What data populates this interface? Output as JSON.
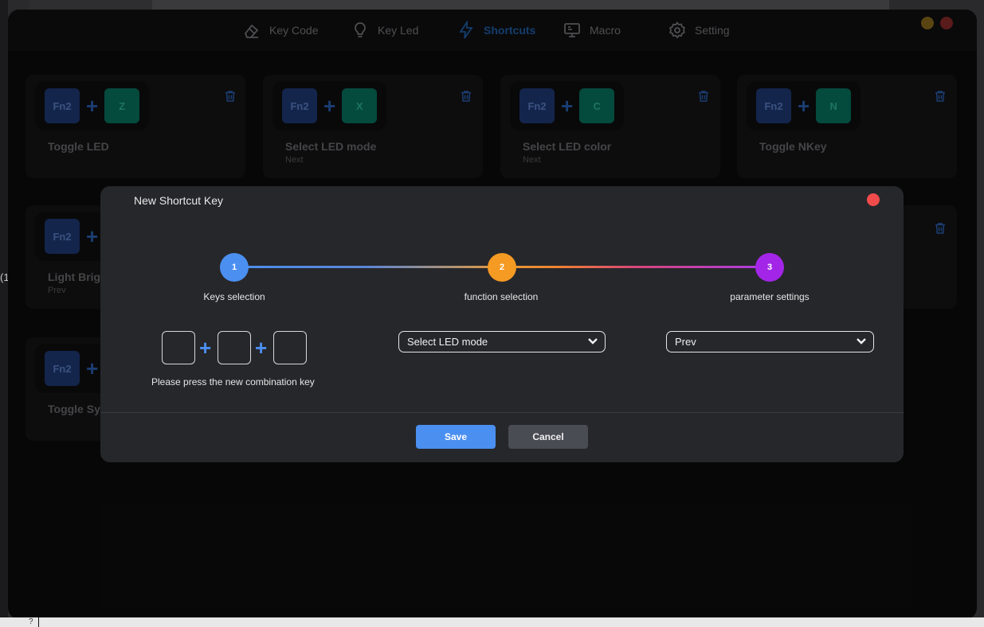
{
  "nav": {
    "tabs": [
      {
        "label": "Key Code",
        "icon": "eraser-icon"
      },
      {
        "label": "Key Led",
        "icon": "lightbulb-icon"
      },
      {
        "label": "Shortcuts",
        "icon": "lightning-icon",
        "active": true
      },
      {
        "label": "Macro",
        "icon": "monitor-icon"
      },
      {
        "label": "Setting",
        "icon": "gear-icon"
      }
    ],
    "active_color": "#1f5fa8"
  },
  "window_controls": {
    "minimize_color": "#8a6a1c",
    "close_color": "#8a2a2a"
  },
  "shortcut_cards": [
    {
      "modifier": "Fn2",
      "key": "Z",
      "title": "Toggle LED",
      "subtitle": ""
    },
    {
      "modifier": "Fn2",
      "key": "X",
      "title": "Select LED mode",
      "subtitle": "Next"
    },
    {
      "modifier": "Fn2",
      "key": "C",
      "title": "Select LED color",
      "subtitle": "Next"
    },
    {
      "modifier": "Fn2",
      "key": "N",
      "title": "Toggle NKey",
      "subtitle": ""
    },
    {
      "modifier": "Fn2",
      "key": "",
      "title": "Light Brig",
      "subtitle": "Prev"
    },
    {
      "modifier": "Fn2",
      "key": "",
      "title": "Toggle Sy",
      "subtitle": ""
    }
  ],
  "side_fragment": "(1",
  "dialog": {
    "title": "New Shortcut Key",
    "steps": [
      {
        "number": "1",
        "label": "Keys selection",
        "color": "#4b8ff0"
      },
      {
        "number": "2",
        "label": "function selection",
        "color": "#f59a22"
      },
      {
        "number": "3",
        "label": "parameter settings",
        "color": "#a326e8"
      }
    ],
    "combo_plus": "+",
    "combo_hint": "Please press the new combination key",
    "function_select": {
      "value": "Select LED mode"
    },
    "parameter_select": {
      "value": "Prev"
    },
    "save_label": "Save",
    "cancel_label": "Cancel"
  },
  "bottom_bar": {
    "text": "?"
  }
}
